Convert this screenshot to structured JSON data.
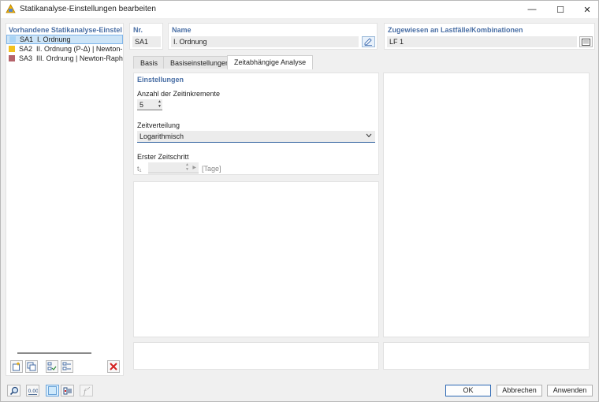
{
  "window": {
    "title": "Statikanalyse-Einstellungen bearbeiten",
    "minimize": "—",
    "maximize": "☐",
    "close": "✕"
  },
  "left": {
    "header": "Vorhandene Statikanalyse-Einstellungen",
    "items": [
      {
        "code": "SA1",
        "label": "I. Ordnung",
        "color": "#a9d4f5",
        "selected": true
      },
      {
        "code": "SA2",
        "label": "II. Ordnung (P-Δ) | Newton-Raphson",
        "color": "#f2c11d",
        "selected": false
      },
      {
        "code": "SA3",
        "label": "III. Ordnung | Newton-Raphson",
        "color": "#b5626a",
        "selected": false
      }
    ]
  },
  "fields": {
    "nr_label": "Nr.",
    "nr_value": "SA1",
    "name_label": "Name",
    "name_value": "I. Ordnung",
    "assigned_label": "Zugewiesen an Lastfälle/Kombinationen",
    "assigned_value": "LF 1"
  },
  "tabs": [
    {
      "label": "Basis",
      "active": false
    },
    {
      "label": "Basiseinstellungen",
      "active": false
    },
    {
      "label": "Zeitabhängige Analyse",
      "active": true
    }
  ],
  "settings": {
    "title": "Einstellungen",
    "increments_label": "Anzahl der Zeitinkremente",
    "increments_value": "5",
    "distribution_label": "Zeitverteilung",
    "distribution_value": "Logarithmisch",
    "first_step_label": "Erster Zeitschritt",
    "first_step_symbol": "t₁",
    "first_step_unit": "[Tage]"
  },
  "buttons": {
    "ok": "OK",
    "cancel": "Abbrechen",
    "apply": "Anwenden"
  }
}
